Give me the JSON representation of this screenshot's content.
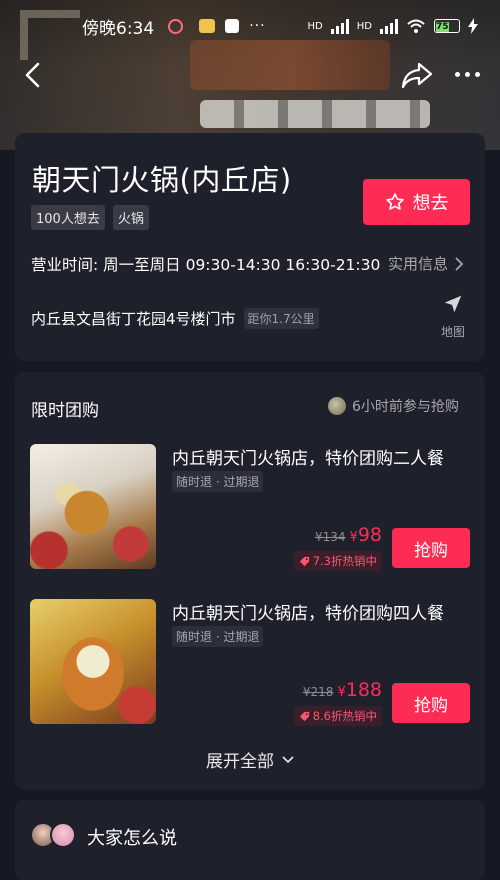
{
  "status_bar": {
    "time": "傍晚6:34",
    "network_1": "HD",
    "network_2": "HD",
    "battery": "75"
  },
  "nav": {
    "back_icon": "chevron-left-icon",
    "share_icon": "share-icon",
    "more_icon": "more-icon"
  },
  "shop": {
    "name": "朝天门火锅(内丘店)",
    "tags": [
      "100人想去",
      "火锅"
    ],
    "want_label": "想去",
    "hours": "营业时间: 周一至周日 09:30-14:30 16:30-21:30",
    "practical_info": "实用信息",
    "address": "内丘县文昌街丁花园4号楼门市",
    "distance": "距你1.7公里",
    "map_label": "地图"
  },
  "deals": {
    "section_title": "限时团购",
    "recent_text": "6小时前参与抢购",
    "items": [
      {
        "name": "内丘朝天门火锅店，特价团购二人餐",
        "refund": "随时退 · 过期退",
        "old_price": "¥134",
        "new_price_symbol": "¥",
        "new_price": "98",
        "discount": "7.3折热销中",
        "buy_label": "抢购"
      },
      {
        "name": "内丘朝天门火锅店，特价团购四人餐",
        "refund": "随时退 · 过期退",
        "old_price": "¥218",
        "new_price_symbol": "¥",
        "new_price": "188",
        "discount": "8.6折热销中",
        "buy_label": "抢购"
      }
    ],
    "expand_label": "展开全部"
  },
  "reviews": {
    "title": "大家怎么说"
  },
  "colors": {
    "accent": "#fe2c55",
    "background": "#161823",
    "card": "#1e202c"
  }
}
